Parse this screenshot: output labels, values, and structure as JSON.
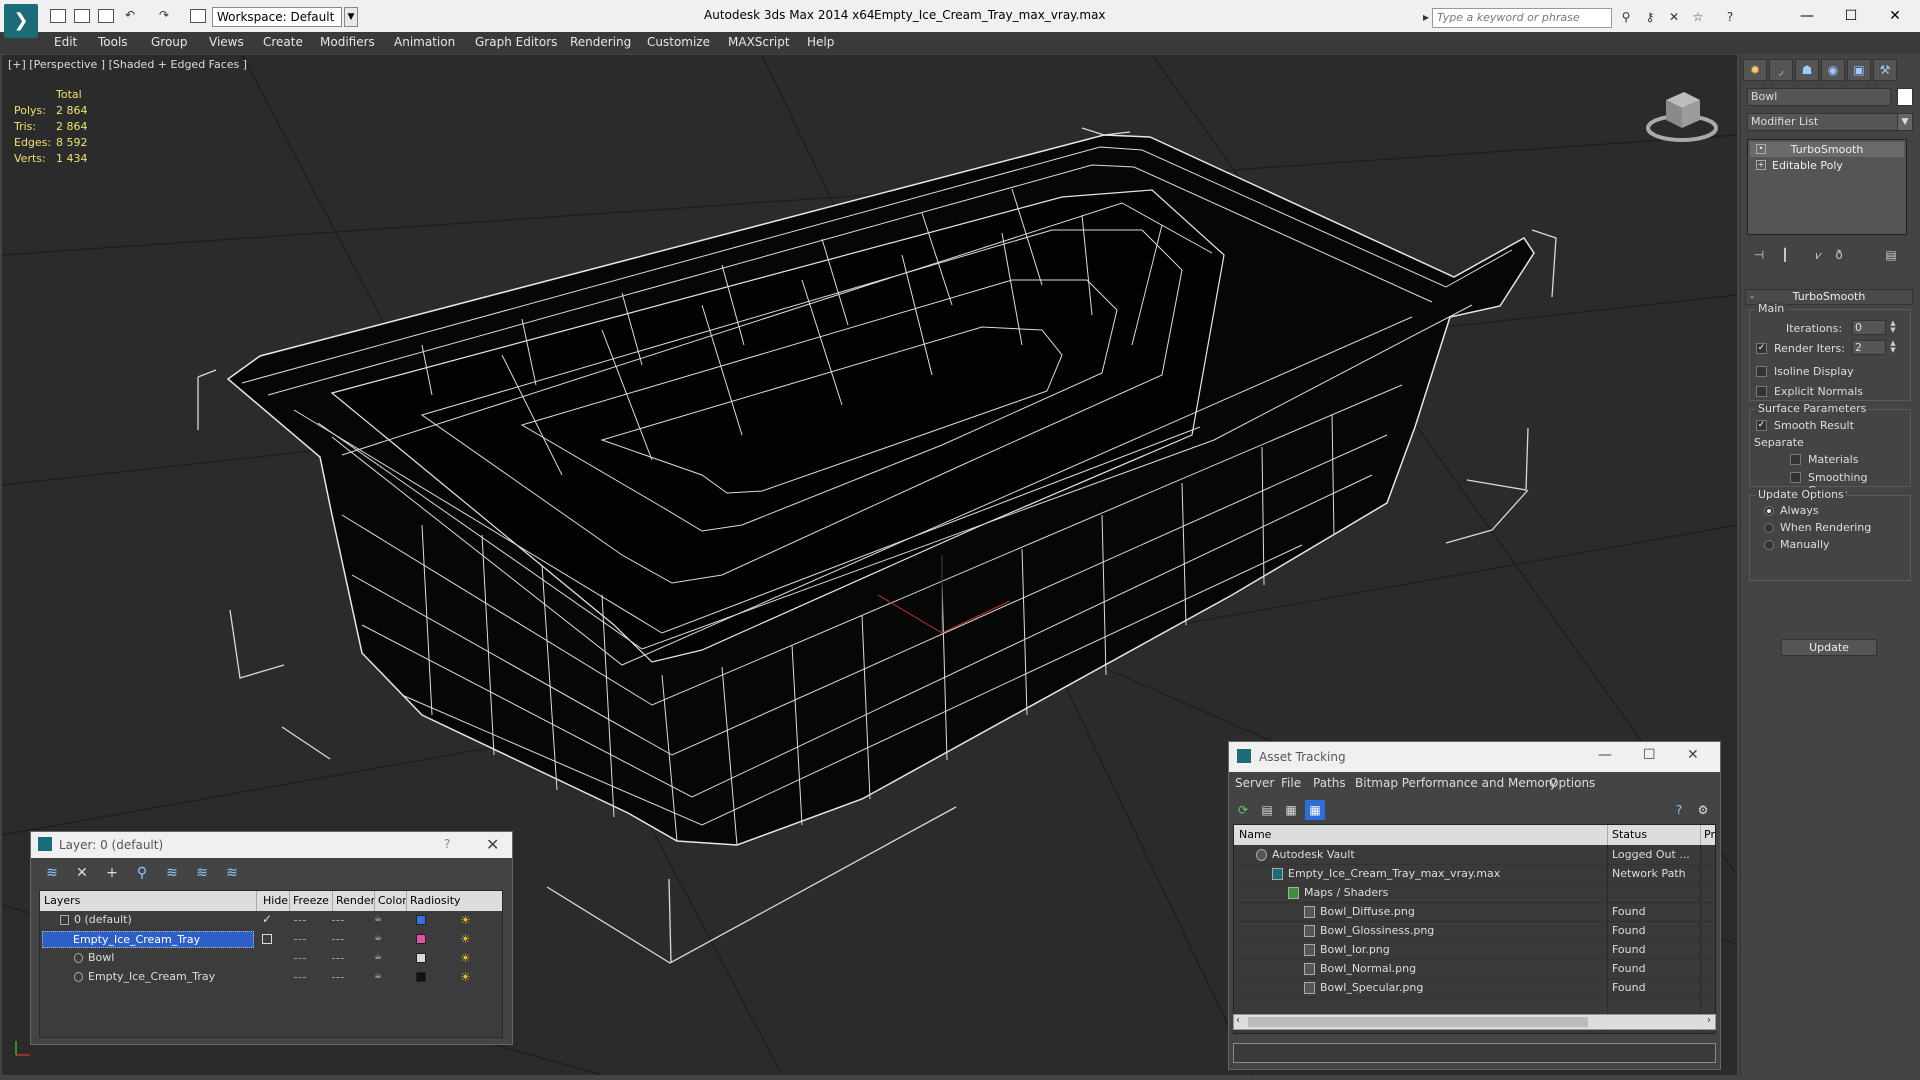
{
  "titlebar": {
    "workspace": "Workspace: Default",
    "app_title": "Autodesk 3ds Max  2014 x64",
    "file_title": "Empty_Ice_Cream_Tray_max_vray.max",
    "search_placeholder": "Type a keyword or phrase"
  },
  "menu": [
    "Edit",
    "Tools",
    "Group",
    "Views",
    "Create",
    "Modifiers",
    "Animation",
    "Graph Editors",
    "Rendering",
    "Customize",
    "MAXScript",
    "Help"
  ],
  "viewport": {
    "label": "[+] [Perspective ] [Shaded + Edged Faces ]",
    "stats": {
      "header": "Total",
      "rows": [
        {
          "k": "Polys:",
          "v": "2 864"
        },
        {
          "k": "Tris:",
          "v": "2 864"
        },
        {
          "k": "Edges:",
          "v": "8 592"
        },
        {
          "k": "Verts:",
          "v": "1 434"
        }
      ]
    }
  },
  "command_panel": {
    "object_name": "Bowl",
    "modifier_list": "Modifier List",
    "stack": [
      "TurboSmooth",
      "Editable Poly"
    ],
    "rollout_title": "TurboSmooth",
    "main_group": "Main",
    "iterations_label": "Iterations:",
    "iterations_value": "0",
    "render_iters_label": "Render Iters:",
    "render_iters_value": "2",
    "isoline": "Isoline Display",
    "explicit_normals": "Explicit Normals",
    "surface_group": "Surface Parameters",
    "smooth_result": "Smooth Result",
    "separate": "Separate",
    "materials": "Materials",
    "smoothing_groups": "Smoothing Groups",
    "update_group": "Update Options",
    "always": "Always",
    "when_rendering": "When Rendering",
    "manually": "Manually",
    "update_button": "Update"
  },
  "layer_window": {
    "title": "Layer: 0 (default)",
    "help": "?",
    "columns": [
      "Layers",
      "Hide",
      "Freeze",
      "Render",
      "Color",
      "Radiosity"
    ],
    "rows": [
      {
        "name": "0 (default)",
        "color": "#3a6fe0"
      },
      {
        "name": "Empty_Ice_Cream_Tray",
        "color": "#e04fa8"
      },
      {
        "name": "Bowl",
        "color": "#d8d8d8"
      },
      {
        "name": "Empty_Ice_Cream_Tray",
        "color": "#111111"
      }
    ]
  },
  "asset_window": {
    "title": "Asset Tracking",
    "menu": [
      "Server",
      "File",
      "Paths",
      "Bitmap Performance and Memory",
      "Options"
    ],
    "columns": [
      "Name",
      "Status",
      "Pr"
    ],
    "rows": [
      {
        "name": "Autodesk Vault",
        "status": "Logged Out ..."
      },
      {
        "name": "Empty_Ice_Cream_Tray_max_vray.max",
        "status": "Network Path"
      },
      {
        "name": "Maps / Shaders",
        "status": ""
      },
      {
        "name": "Bowl_Diffuse.png",
        "status": "Found"
      },
      {
        "name": "Bowl_Glossiness.png",
        "status": "Found"
      },
      {
        "name": "Bowl_Ior.png",
        "status": "Found"
      },
      {
        "name": "Bowl_Normal.png",
        "status": "Found"
      },
      {
        "name": "Bowl_Specular.png",
        "status": "Found"
      }
    ]
  },
  "colors": {
    "stats_text": "#f0e070",
    "selection": "#2d5fc7",
    "viewport_bg": "#2b2b2b"
  }
}
